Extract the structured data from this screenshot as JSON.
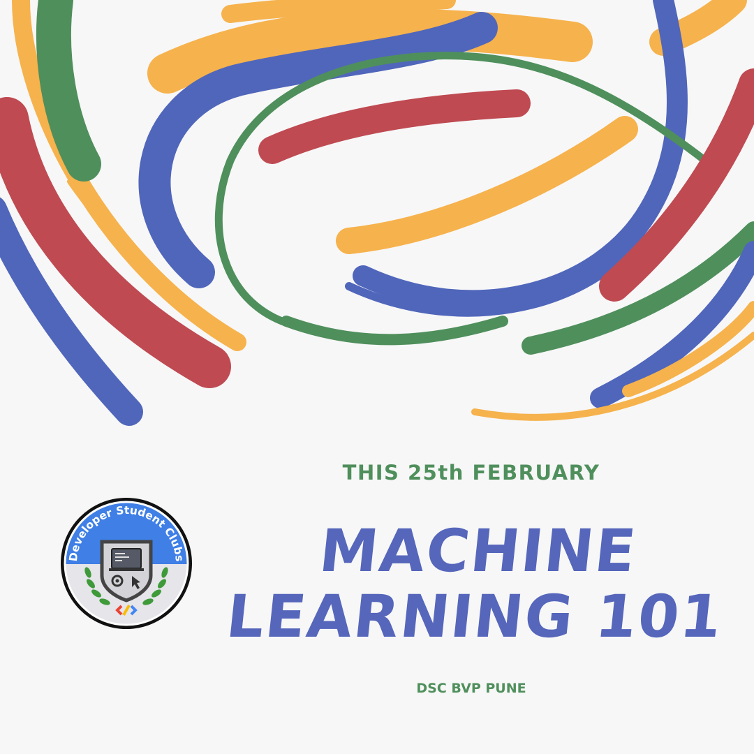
{
  "colors": {
    "background": "#f7f7f7",
    "blue": "#5066bb",
    "red": "#bf4a52",
    "yellow": "#f6b24c",
    "green": "#4f8f5c"
  },
  "event": {
    "date_line": "THIS 25th FEBRUARY",
    "title_line1": "MACHINE",
    "title_line2": "LEARNING 101",
    "organizer": "DSC BVP PUNE"
  },
  "badge": {
    "arc_text": "Developer Student Clubs",
    "icons": [
      "laptop-icon",
      "gear-icon",
      "cursor-icon",
      "chevron-logo-icon",
      "laurel-icon"
    ]
  }
}
